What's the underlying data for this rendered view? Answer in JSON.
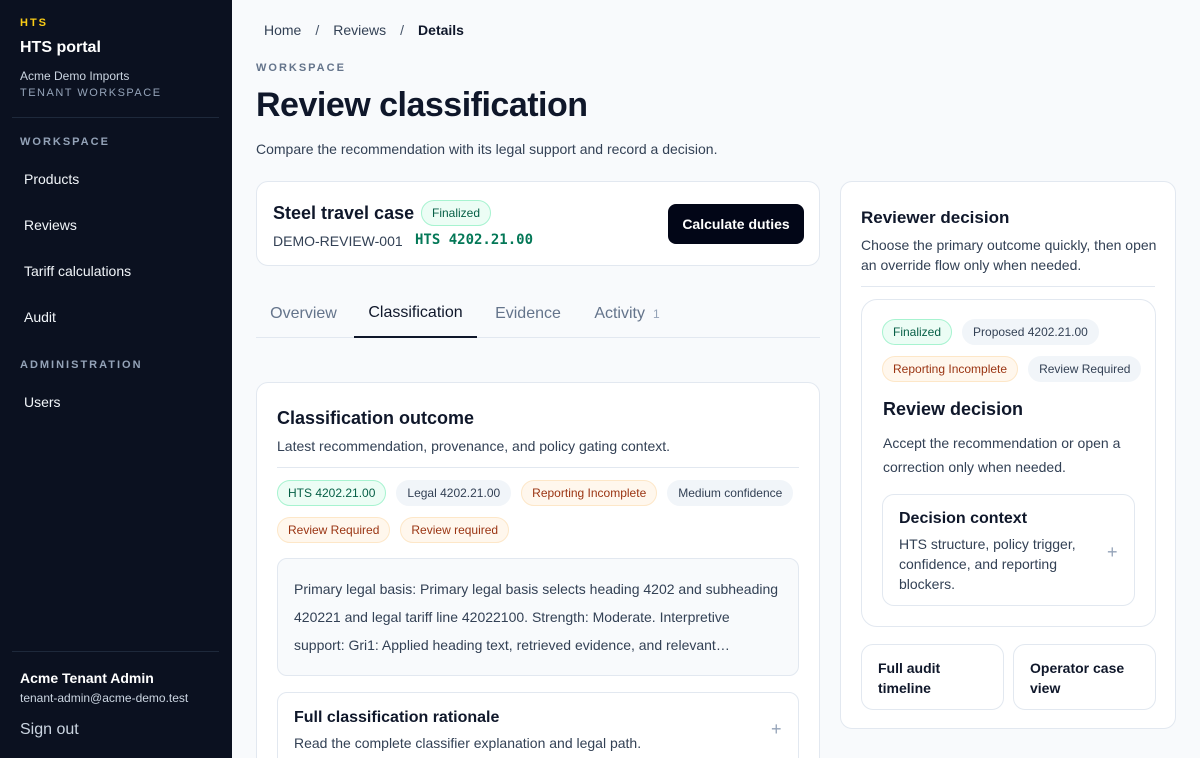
{
  "sidebar": {
    "brand_eyebrow": "HTS",
    "brand_title": "HTS portal",
    "tenant_name": "Acme Demo Imports",
    "tenant_sub": "TENANT WORKSPACE",
    "workspace_label": "WORKSPACE",
    "workspace_items": [
      "Products",
      "Reviews",
      "Tariff calculations",
      "Audit"
    ],
    "admin_label": "ADMINISTRATION",
    "admin_items": [
      "Users"
    ],
    "user_name": "Acme Tenant Admin",
    "user_email": "tenant-admin@acme-demo.test",
    "sign_out": "Sign out"
  },
  "breadcrumb": {
    "items": [
      "Home",
      "Reviews",
      "Details"
    ],
    "separator": "/"
  },
  "header": {
    "eyebrow": "WORKSPACE",
    "title": "Review classification",
    "subtitle": "Compare the recommendation with its legal support and record a decision."
  },
  "case": {
    "title": "Steel travel case",
    "status": "Finalized",
    "id": "DEMO-REVIEW-001",
    "hts": "HTS 4202.21.00",
    "calculate_label": "Calculate duties"
  },
  "tabs": [
    {
      "label": "Overview",
      "count": ""
    },
    {
      "label": "Classification",
      "count": ""
    },
    {
      "label": "Evidence",
      "count": ""
    },
    {
      "label": "Activity",
      "count": "1"
    }
  ],
  "active_tab": "Classification",
  "outcome": {
    "title": "Classification outcome",
    "subtitle": "Latest recommendation, provenance, and policy gating context.",
    "chips_row1": [
      "HTS 4202.21.00",
      "Legal 4202.21.00",
      "Reporting Incomplete",
      "Medium confidence"
    ],
    "chips_row2": [
      "Review Required",
      "Review required"
    ],
    "basis_text": "Primary legal basis: Primary legal basis selects heading 4202 and subheading 420221 and legal tariff line 42022100. Strength: Moderate. Interpretive support: Gri1: Applied heading text, retrieved evidence, and relevant…",
    "rationale_title": "Full classification rationale",
    "rationale_sub": "Read the complete classifier explanation and legal path."
  },
  "decision": {
    "title": "Reviewer decision",
    "subtitle": "Choose the primary outcome quickly, then open an override flow only when needed.",
    "chips_row1": [
      "Finalized",
      "Proposed 4202.21.00"
    ],
    "chips_row2": [
      "Reporting Incomplete",
      "Review Required"
    ],
    "review_title": "Review decision",
    "review_sub": "Accept the recommendation or open a correction only when needed.",
    "context_title": "Decision context",
    "context_sub": "HTS structure, policy trigger, confidence, and reporting blockers.",
    "audit_label": "Full audit timeline",
    "operator_label": "Operator case view"
  },
  "colors": {
    "sidebar_bg": "#0b1120",
    "brand_accent": "#facc15",
    "success": "#047857",
    "warning": "#9a3412",
    "primary_button": "#020617"
  },
  "icons": {
    "expand": "plus-icon"
  }
}
